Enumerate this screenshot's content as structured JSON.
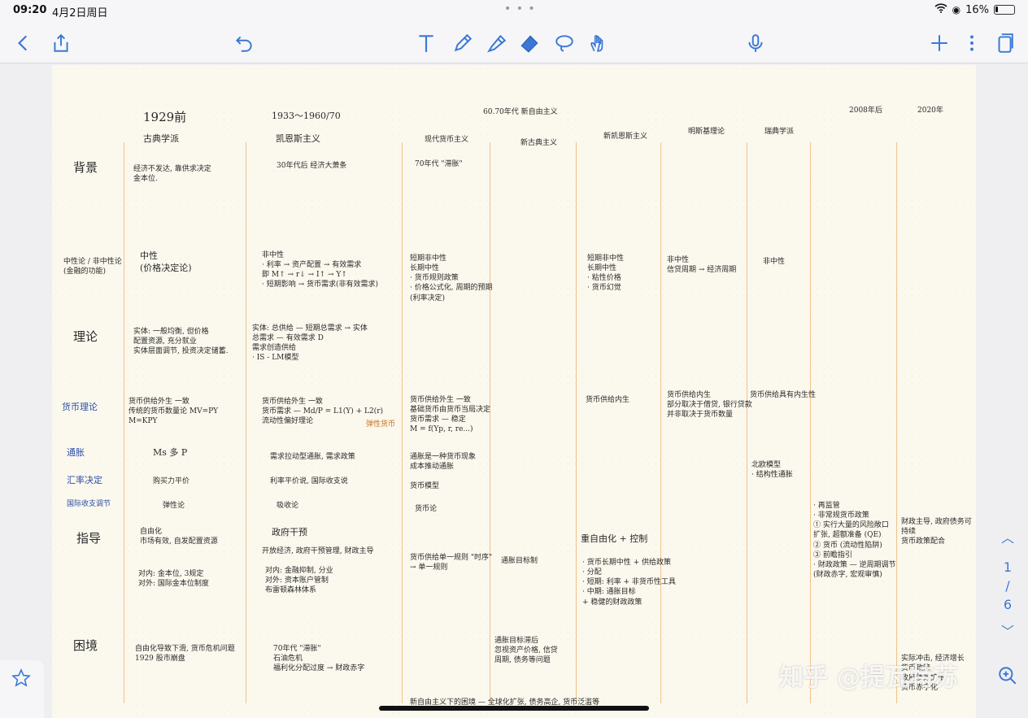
{
  "status": {
    "time": "09:20",
    "date": "4月2日周日",
    "battery": "16%",
    "battery_level": 0.16
  },
  "toolbar": {
    "icons": [
      "back-icon",
      "share-icon",
      "undo-icon",
      "text-icon",
      "pen-icon",
      "highlighter-icon",
      "eraser-icon",
      "lasso-icon",
      "hand-icon",
      "mic-icon",
      "add-icon",
      "more-icon",
      "pages-icon"
    ]
  },
  "notes": {
    "h_1929": "1929前",
    "h_classic": "古典学派",
    "h_1933": "1933～1960/70",
    "h_keynes": "凯恩斯主义",
    "h_6070": "60.70年代 新自由主义",
    "h_modern_money": "现代货币主义",
    "h_new_classic": "新古典主义",
    "h_new_keynes": "新凯恩斯主义",
    "h_mmt": "明斯基理论",
    "h_swedish": "瑞典学派",
    "h_2008": "2008年后",
    "h_2020": "2020年",
    "row_bg": "背景",
    "row_neutral": "中性论 / 非中性论\n(金融的功能)",
    "row_theory": "理论",
    "row_money": "货币理论",
    "row_inflation": "通胀",
    "row_fx": "汇率决定",
    "row_trade": "国际收支调节",
    "row_guide": "指导",
    "row_dilemma": "困境",
    "c1_bg": "经济不发达, 靠供求决定\n金本位.",
    "c1_neutral": "中性\n(价格决定论)",
    "c1_theory": "实体: 一般均衡, 但价格\n配置资源, 充分就业\n实体层面调节, 投资决定储蓄.",
    "c1_money": "货币供给外生 一致\n传统的货币数量论 MV=PY\nM=KPY",
    "c1_inflation": "Ms 多 P",
    "c1_fx": "购买力平价",
    "c1_trade": "弹性论",
    "c1_guide": "自由化\n市场有效, 自发配置资源",
    "c1_guide2": "对内: 金本位, 3规定\n对外: 国际金本位制度",
    "c1_dilemma": "自由化导致下滑, 货币危机问题\n1929 股市崩盘",
    "c2_bg": "30年代后 经济大萧条",
    "c2_neutral": "非中性\n· 利率 → 资产配置 → 有效需求\n即 M↑ → r↓ → I↑ → Y↑\n· 短期影响 → 货币需求(非有效需求)",
    "c2_theory": "实体: 总供给 — 短期总需求 → 实体\n总需求 — 有效需求 D\n需求创造供给\n· IS - LM模型",
    "c2_money": "货币供给外生 一致\n货币需求 — Md/P = L1(Y) + L2(r)\n流动性偏好理论",
    "c2_money_note": "弹性货币",
    "c2_inflation": "需求拉动型通胀, 需求政策",
    "c2_fx": "利率平价说, 国际收支说",
    "c2_trade": "吸收论",
    "c2_guide": "政府干预",
    "c2_guide2": "开放经济, 政府干预管理, 财政主导",
    "c2_guide3": "对内: 金融抑制, 分业\n对外: 资本账户管制\n布雷顿森林体系",
    "c2_dilemma": "70年代 \"滞胀\"\n石油危机\n福利化分配过度 → 财政赤字",
    "c3_bg": "70年代 \"滞胀\"",
    "c3_neutral": "短期非中性\n长期中性\n· 货币规则政策\n· 价格公式化, 周期的预期\n(利率决定)",
    "c3_money": "货币供给外生 一致\n基础货币由货币当局决定\n货币需求 — 稳定\nM = f(Yp, r, re...)",
    "c3_inflation": "通胀是一种货币现象\n成本推动通胀",
    "c3_fx": "货币模型",
    "c3_trade": "货币论",
    "c3_guide": "货币供给单一规则 \"时序\"\n→ 单一规则",
    "c4_guide": "通胀目标制",
    "c4_dilemma": "通胀目标滞后\n忽视资产价格, 信贷\n周期, 债务等问题",
    "c5_neutral": "短期非中性\n长期中性\n· 粘性价格\n· 货币幻觉",
    "c5_money": "货币供给内生",
    "c5_guide": "重自由化 + 控制",
    "c5_guide2": "· 货币长期中性 + 供给政策\n· 分配\n· 短期: 利率 + 非货币性工具\n· 中期: 通胀目标\n+ 稳健的财政政策",
    "c6_neutral": "非中性\n信贷周期 → 经济周期",
    "c6_money": "货币供给内生\n部分取决于借贷, 银行贷款\n并非取决于货币数量",
    "c7_neutral": "非中性",
    "c7_money": "货币供给具有内生性",
    "c7_fx": "北欧模型\n· 结构性通胀",
    "c8_guide": "· 再监管\n· 非常规货币政策\n① 实行大量的风险敞口\n扩张, 超额准备 (QE)\n② 货币 (流动性陷阱)\n③ 前瞻指引\n· 财政政策 — 逆周期调节\n(财政赤字, 宏观审慎)",
    "c9_guide": "财政主导, 政府债务可持续\n货币政策配合",
    "c9_dilemma": "实际冲击, 经济增长\n货币政策\n政府债务扩张\n货币赤字化",
    "bottom": "新自由主义下的困境 — 全球化扩张, 债务高企, 货币泛滥等",
    "watermark": "知乎 @提瓦特苏"
  },
  "pager": {
    "current": "1",
    "sep": "/",
    "total": "6"
  }
}
